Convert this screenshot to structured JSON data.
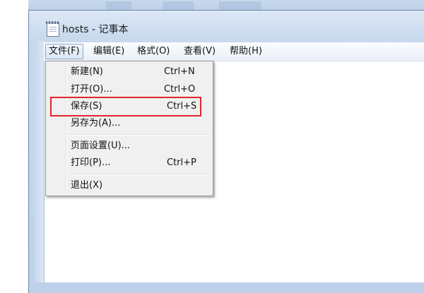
{
  "window": {
    "title": "hosts - 记事本",
    "icon": "notepad-icon"
  },
  "menubar": {
    "items": [
      {
        "label": "文件(F)"
      },
      {
        "label": "编辑(E)"
      },
      {
        "label": "格式(O)"
      },
      {
        "label": "查看(V)"
      },
      {
        "label": "帮助(H)"
      }
    ]
  },
  "file_menu": {
    "items": [
      {
        "label": "新建(N)",
        "shortcut": "Ctrl+N"
      },
      {
        "label": "打开(O)...",
        "shortcut": "Ctrl+O"
      },
      {
        "label": "保存(S)",
        "shortcut": "Ctrl+S"
      },
      {
        "label": "另存为(A)...",
        "shortcut": ""
      },
      {
        "label": "页面设置(U)...",
        "shortcut": ""
      },
      {
        "label": "打印(P)...",
        "shortcut": "Ctrl+P"
      },
      {
        "label": "退出(X)",
        "shortcut": ""
      }
    ]
  },
  "colors": {
    "highlight_box": "#e0262c",
    "frame": "#c8d9ed"
  }
}
